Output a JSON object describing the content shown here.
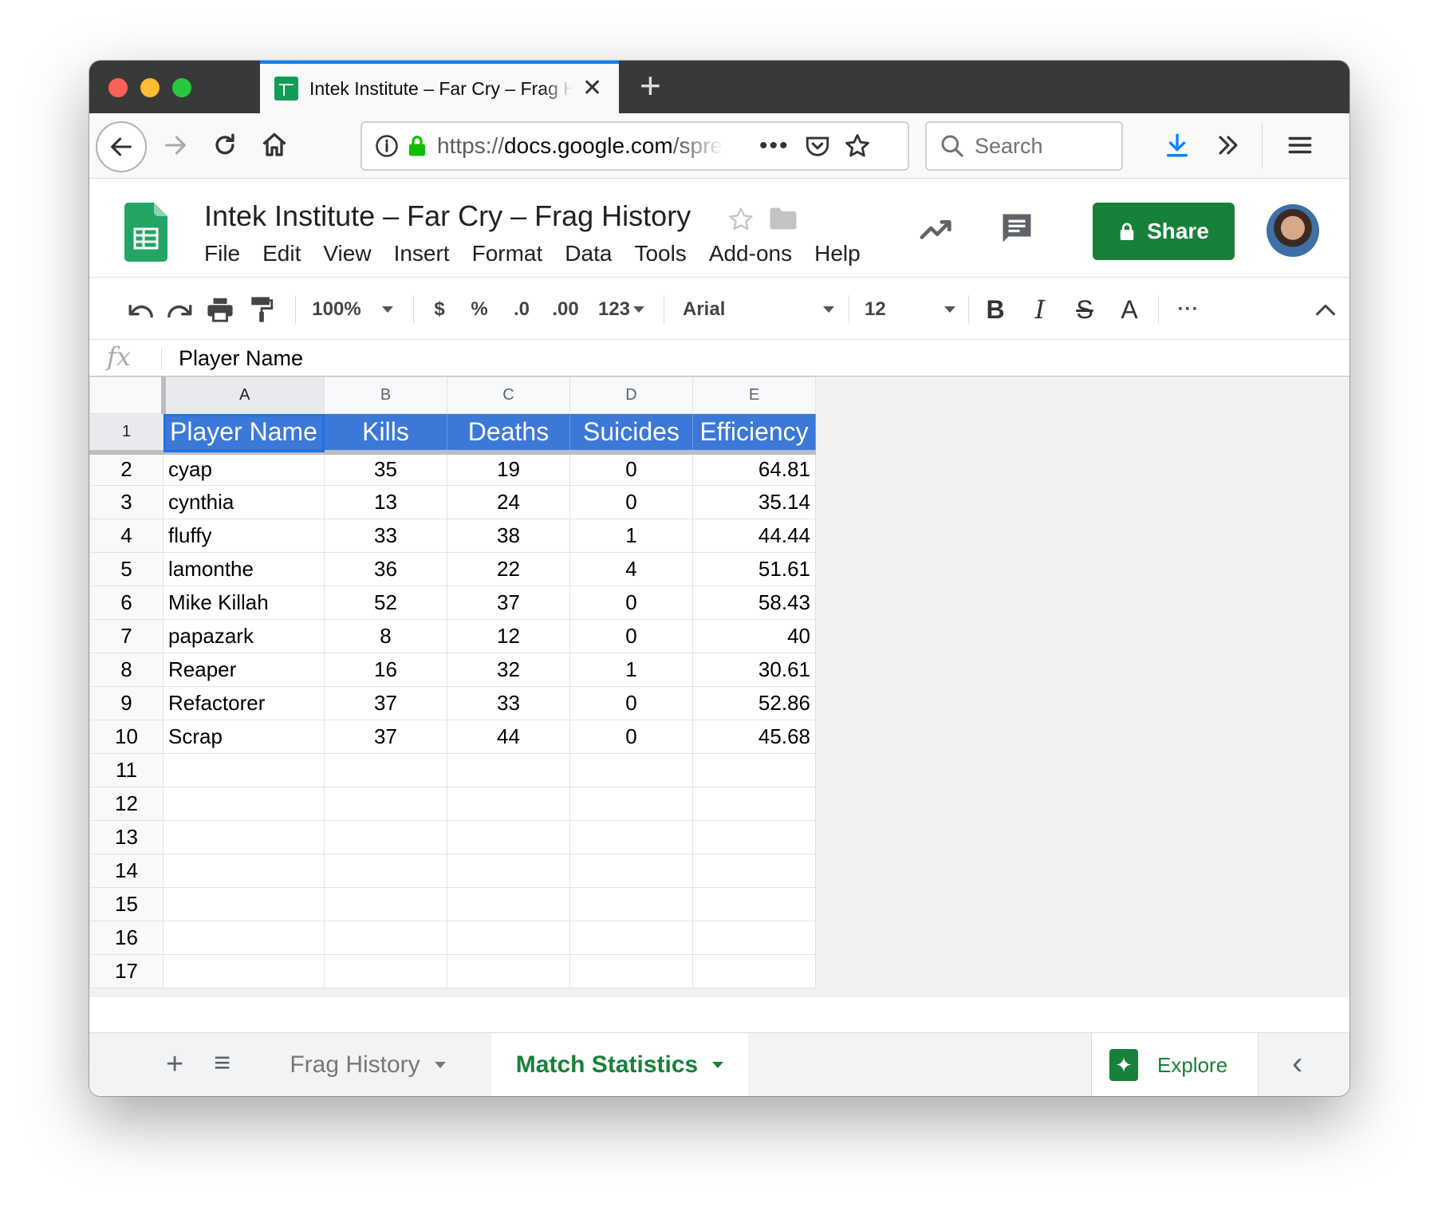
{
  "browser": {
    "tab_title": "Intek Institute – Far Cry – Frag History",
    "url_scheme": "https://",
    "url_domain": "docs.google.com",
    "url_rest": "/spreadsheets",
    "search_placeholder": "Search"
  },
  "app": {
    "doc_title": "Intek Institute – Far Cry – Frag History",
    "menu": [
      "File",
      "Edit",
      "View",
      "Insert",
      "Format",
      "Data",
      "Tools",
      "Add-ons",
      "Help"
    ],
    "share_label": "Share",
    "accent_color": "#188038"
  },
  "toolbar": {
    "zoom": "100%",
    "currency": "$",
    "percent": "%",
    "dec_decrease": ".0",
    "dec_increase": ".00",
    "more_formats": "123",
    "font": "Arial",
    "font_size": "12",
    "bold": "B",
    "italic": "I",
    "strike": "S",
    "text_color": "A",
    "more": "···"
  },
  "formula": {
    "fx": "fx",
    "value": "Player Name"
  },
  "sheet": {
    "columns": [
      "A",
      "B",
      "C",
      "D",
      "E"
    ],
    "header_row": [
      "Player Name",
      "Kills",
      "Deaths",
      "Suicides",
      "Efficiency"
    ],
    "header_color": "#3c78d8",
    "rows": [
      [
        "cyap",
        "35",
        "19",
        "0",
        "64.81"
      ],
      [
        "cynthia",
        "13",
        "24",
        "0",
        "35.14"
      ],
      [
        "fluffy",
        "33",
        "38",
        "1",
        "44.44"
      ],
      [
        "lamonthe",
        "36",
        "22",
        "4",
        "51.61"
      ],
      [
        "Mike Killah",
        "52",
        "37",
        "0",
        "58.43"
      ],
      [
        "papazark",
        "8",
        "12",
        "0",
        "40"
      ],
      [
        "Reaper",
        "16",
        "32",
        "1",
        "30.61"
      ],
      [
        "Refactorer",
        "37",
        "33",
        "0",
        "52.86"
      ],
      [
        "Scrap",
        "37",
        "44",
        "0",
        "45.68"
      ]
    ],
    "row_numbers": [
      "1",
      "2",
      "3",
      "4",
      "5",
      "6",
      "7",
      "8",
      "9",
      "10",
      "11",
      "12",
      "13",
      "14",
      "15",
      "16",
      "17"
    ]
  },
  "tabs": {
    "add": "+",
    "list": "≡",
    "sheets": [
      {
        "label": "Frag History",
        "active": false
      },
      {
        "label": "Match Statistics",
        "active": true
      }
    ],
    "explore_label": "Explore",
    "collapse": "‹"
  }
}
